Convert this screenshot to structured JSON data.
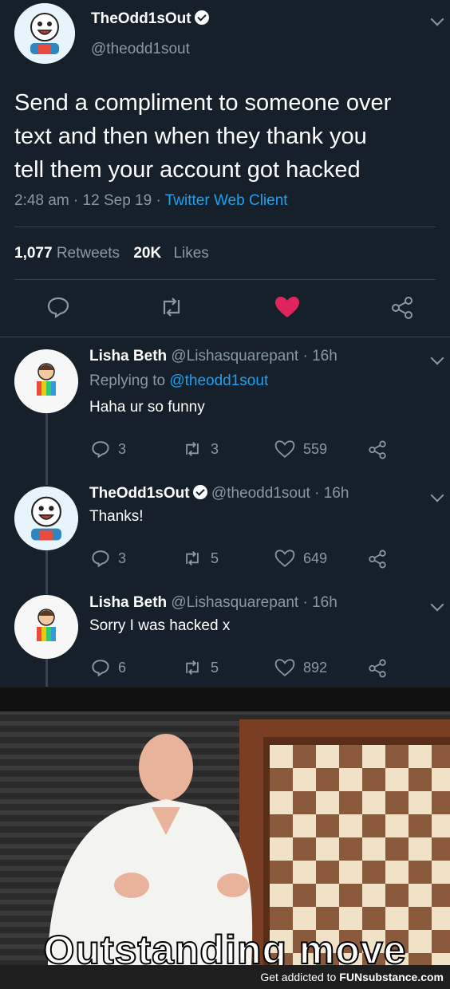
{
  "main_tweet": {
    "name": "TheOdd1sOut",
    "handle": "@theodd1sout",
    "text_lines": [
      "Send a compliment to someone over",
      "text and then when they thank you",
      "tell them your account got hacked"
    ],
    "time": "2:48 am",
    "date": "12 Sep 19",
    "client": "Twitter Web Client",
    "retweets_count": "1,077",
    "retweets_label": "Retweets",
    "likes_count": "20K",
    "likes_label": "Likes"
  },
  "replies": [
    {
      "name": "Lisha Beth",
      "handle": "@Lishasquarepant",
      "age": "16h",
      "replying_label": "Replying to",
      "replying_to": "@theodd1sout",
      "text": "Haha ur so funny",
      "replies": "3",
      "retweets": "3",
      "likes": "559"
    },
    {
      "name": "TheOdd1sOut",
      "handle": "@theodd1sout",
      "age": "16h",
      "text": "Thanks!",
      "replies": "3",
      "retweets": "5",
      "likes": "649"
    },
    {
      "name": "Lisha Beth",
      "handle": "@Lishasquarepant",
      "age": "16h",
      "text": "Sorry I was hacked x",
      "replies": "6",
      "retweets": "5",
      "likes": "892"
    }
  ],
  "meme": {
    "caption": "Outstanding move"
  },
  "footer": {
    "text": "Get addicted to",
    "brand": "FUNsubstance.com"
  },
  "colors": {
    "background": "#15202b",
    "accent": "#1da1f2",
    "like_red": "#e0245e",
    "muted": "#8899a6"
  }
}
